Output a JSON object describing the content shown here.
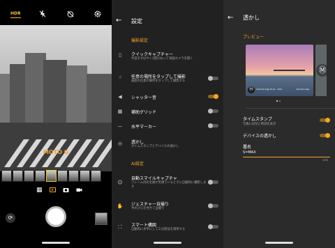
{
  "camera": {
    "hdr_label": "HDR",
    "top_icons": [
      "flash-off-icon",
      "timer-off-icon",
      "settings-gear-icon"
    ],
    "watermark_overlay": "MOTO G",
    "modes": [
      "grid-icon",
      "slideshow-icon",
      "camera-icon",
      "video-icon"
    ],
    "active_mode": "camera-icon"
  },
  "settings": {
    "title": "設定",
    "section_capture": "撮影設定",
    "section_ai": "AI設定",
    "items": [
      {
        "title": "クイックキャプチャー",
        "subtitle": "手首をすばやく2回ひねって背面カメラを開く",
        "toggle": null
      },
      {
        "title": "任意の場所をタップして撮影",
        "subtitle": "画面の任意の場所をタップして撮影する",
        "toggle": false
      },
      {
        "title": "シャッター音",
        "subtitle": "",
        "toggle": true
      },
      {
        "title": "補助グリッド",
        "subtitle": "",
        "toggle": false
      },
      {
        "title": "水平マーカー",
        "subtitle": "",
        "toggle": false
      },
      {
        "title": "透かし",
        "subtitle": "タイムスタンプとデバイスの透かし",
        "toggle": null
      },
      {
        "title": "自動スマイルキャプチャ",
        "subtitle": "フレーム内の全員が笑顔でいるときに自動的に撮影します",
        "toggle": false
      },
      {
        "title": "ジェスチャー自撮り",
        "subtitle": "手のひらを見せて自撮り",
        "toggle": false
      },
      {
        "title": "スマート構図",
        "subtitle": "自動的に水平にして三分割法を適用する",
        "toggle": false
      }
    ]
  },
  "watermark": {
    "title": "透かし",
    "preview_label": "プレビュー",
    "timestamp_title": "タイムスタンプ",
    "timestamp_sub": "写真に日付と時刻を表示",
    "timestamp_on": true,
    "device_title": "デバイスの透かし",
    "device_on": true,
    "signature_label": "署名",
    "signature_value": "S=MAX",
    "counter": "5/30",
    "caption_left": "motorola edge 20 pro · 2021",
    "caption_right": "motorola edge"
  },
  "colors": {
    "accent": "#f5a623",
    "panel_bg": "#212121",
    "text": "#ffffff"
  }
}
